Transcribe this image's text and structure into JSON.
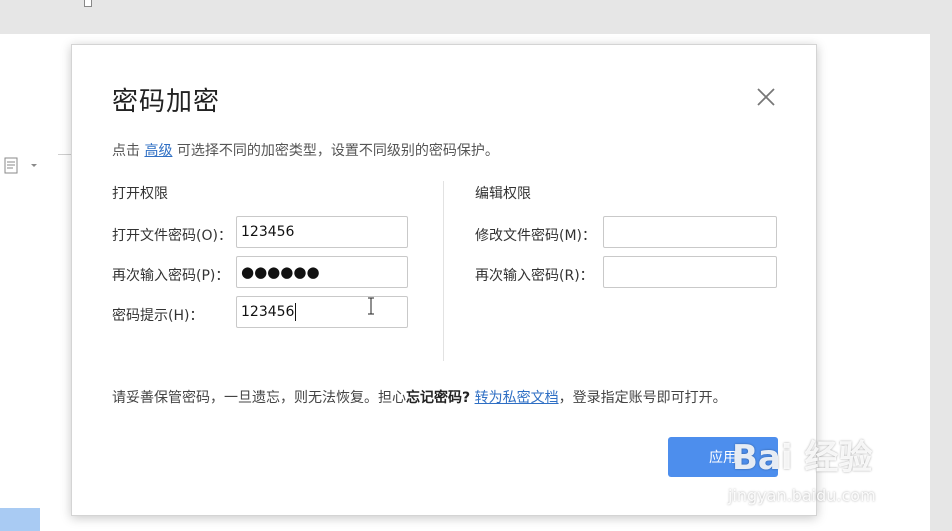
{
  "dialog": {
    "title": "密码加密",
    "close_icon": "close-icon",
    "description": {
      "prefix": "点击 ",
      "link": "高级",
      "suffix": " 可选择不同的加密类型，设置不同级别的密码保护。"
    },
    "open_permission": {
      "section_title": "打开权限",
      "fields": [
        {
          "label": "打开文件密码(O)：",
          "value": "123456"
        },
        {
          "label": "再次输入密码(P)：",
          "value": "●●●●●●"
        },
        {
          "label": "密码提示(H)：",
          "value": "123456"
        }
      ]
    },
    "edit_permission": {
      "section_title": "编辑权限",
      "fields": [
        {
          "label": "修改文件密码(M)：",
          "value": ""
        },
        {
          "label": "再次输入密码(R)：",
          "value": ""
        }
      ]
    },
    "notice": {
      "prefix": "请妥善保管密码，一旦遗忘，则无法恢复。担心",
      "bold": "忘记密码?",
      "link": "转为私密文档",
      "suffix": "，登录指定账号即可打开。"
    },
    "apply_label": "应用"
  },
  "watermark": {
    "logo_text": "Bai 经验",
    "url_text": "jingyan.baidu.com"
  },
  "colors": {
    "accent": "#4d8eed",
    "link": "#2f6fc4"
  }
}
